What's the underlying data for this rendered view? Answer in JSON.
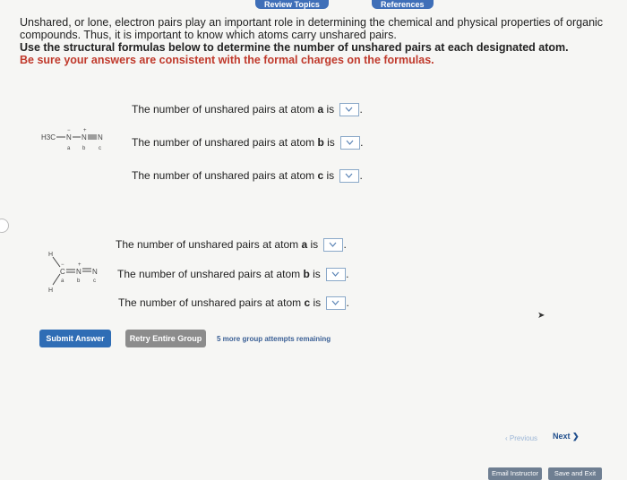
{
  "top_tabs": {
    "review": "Review Topics",
    "references": "References"
  },
  "intro": {
    "line1": "Unshared, or lone, electron pairs play an important role in determining the chemical and physical properties of organic",
    "line2": "compounds. Thus, it is important to know which atoms carry unshared pairs.",
    "line3": "Use the structural formulas below to determine the number of unshared pairs at each designated atom.",
    "line4": "Be sure your answers are consistent with the formal charges on the formulas."
  },
  "group1": {
    "questions": [
      {
        "prefix": "The number of unshared pairs at atom ",
        "atom": "a",
        "suffix": " is"
      },
      {
        "prefix": "The number of unshared pairs at atom ",
        "atom": "b",
        "suffix": " is"
      },
      {
        "prefix": "The number of unshared pairs at atom ",
        "atom": "c",
        "suffix": " is"
      }
    ],
    "molecule": {
      "h3c": "H3C",
      "n1": "N",
      "n2": "N",
      "n3": "N",
      "a": "a",
      "b": "b",
      "c": "c",
      "minus": "−",
      "plus": "+"
    }
  },
  "group2": {
    "questions": [
      {
        "prefix": "The number of unshared pairs at atom ",
        "atom": "a",
        "suffix": " is"
      },
      {
        "prefix": "The number of unshared pairs at atom ",
        "atom": "b",
        "suffix": " is"
      },
      {
        "prefix": "The number of unshared pairs at atom ",
        "atom": "c",
        "suffix": " is"
      }
    ],
    "molecule": {
      "h": "H",
      "c": "C",
      "n1": "N",
      "n2": "N",
      "a": "a",
      "b": "b",
      "c_label": "c",
      "minus": "−",
      "plus": "+"
    }
  },
  "buttons": {
    "submit": "Submit Answer",
    "retry": "Retry Entire Group"
  },
  "attempts": "5 more group attempts remaining",
  "nav": {
    "previous": "Previous",
    "next": "Next"
  },
  "footer": {
    "email": "Email Instructor",
    "save": "Save and Exit"
  },
  "colors": {
    "primary": "#2f6db5",
    "alert_text": "#c0392b"
  }
}
